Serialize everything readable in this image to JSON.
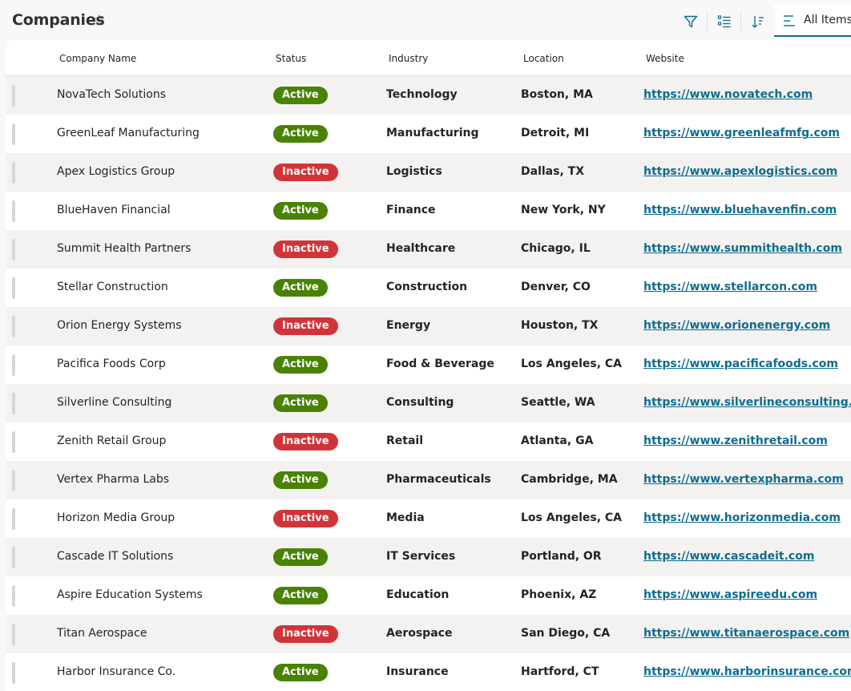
{
  "header": {
    "title": "Companies",
    "favorite_icon": "star-outline-icon",
    "toolbar": {
      "filter_icon": "filter-icon",
      "group_icon": "list-group-icon",
      "sort_icon": "sort-icon",
      "view_label": "All Items",
      "view_icon": "lines-icon"
    }
  },
  "columns": [
    "Company Name",
    "Status",
    "Industry",
    "Location",
    "Website"
  ],
  "colors": {
    "active": "#498205",
    "inactive": "#d13438",
    "link": "#0f6c8e"
  },
  "rows": [
    {
      "name": "NovaTech Solutions",
      "status": "Active",
      "industry": "Technology",
      "location": "Boston, MA",
      "website": "https://www.novatech.com"
    },
    {
      "name": "GreenLeaf Manufacturing",
      "status": "Active",
      "industry": "Manufacturing",
      "location": "Detroit, MI",
      "website": "https://www.greenleafmfg.com"
    },
    {
      "name": "Apex Logistics Group",
      "status": "Inactive",
      "industry": "Logistics",
      "location": "Dallas, TX",
      "website": "https://www.apexlogistics.com"
    },
    {
      "name": "BlueHaven Financial",
      "status": "Active",
      "industry": "Finance",
      "location": "New York, NY",
      "website": "https://www.bluehavenfin.com"
    },
    {
      "name": "Summit Health Partners",
      "status": "Inactive",
      "industry": "Healthcare",
      "location": "Chicago, IL",
      "website": "https://www.summithealth.com"
    },
    {
      "name": "Stellar Construction",
      "status": "Active",
      "industry": "Construction",
      "location": "Denver, CO",
      "website": "https://www.stellarcon.com"
    },
    {
      "name": "Orion Energy Systems",
      "status": "Inactive",
      "industry": "Energy",
      "location": "Houston, TX",
      "website": "https://www.orionenergy.com"
    },
    {
      "name": "Pacifica Foods Corp",
      "status": "Active",
      "industry": "Food & Beverage",
      "location": "Los Angeles, CA",
      "website": "https://www.pacificafoods.com"
    },
    {
      "name": "Silverline Consulting",
      "status": "Active",
      "industry": "Consulting",
      "location": "Seattle, WA",
      "website": "https://www.silverlineconsulting.com"
    },
    {
      "name": "Zenith Retail Group",
      "status": "Inactive",
      "industry": "Retail",
      "location": "Atlanta, GA",
      "website": "https://www.zenithretail.com"
    },
    {
      "name": "Vertex Pharma Labs",
      "status": "Active",
      "industry": "Pharmaceuticals",
      "location": "Cambridge, MA",
      "website": "https://www.vertexpharma.com"
    },
    {
      "name": "Horizon Media Group",
      "status": "Inactive",
      "industry": "Media",
      "location": "Los Angeles, CA",
      "website": "https://www.horizonmedia.com"
    },
    {
      "name": "Cascade IT Solutions",
      "status": "Active",
      "industry": "IT Services",
      "location": "Portland, OR",
      "website": "https://www.cascadeit.com"
    },
    {
      "name": "Aspire Education Systems",
      "status": "Active",
      "industry": "Education",
      "location": "Phoenix, AZ",
      "website": "https://www.aspireedu.com"
    },
    {
      "name": "Titan Aerospace",
      "status": "Inactive",
      "industry": "Aerospace",
      "location": "San Diego, CA",
      "website": "https://www.titanaerospace.com"
    },
    {
      "name": "Harbor Insurance Co.",
      "status": "Active",
      "industry": "Insurance",
      "location": "Hartford, CT",
      "website": "https://www.harborinsurance.com"
    }
  ]
}
